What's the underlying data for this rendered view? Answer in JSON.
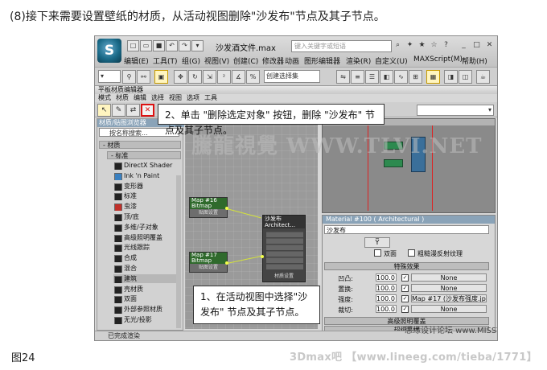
{
  "heading": "(8)接下来需要设置壁纸的材质，从活动视图删除\"沙发布\"节点及其子节点。",
  "caption": "图24",
  "footer_watermark": "3Dmax吧  【www.lineeg.com/tieba/1771】",
  "max_window": {
    "app_logo": "S",
    "doc_title": "沙发酒文件.max",
    "search_placeholder": "键入关键字或短语",
    "menus": [
      "编辑(E)",
      "工具(T)",
      "组(G)",
      "视图(V)",
      "创建(C)",
      "修改器",
      "动画",
      "图形编辑器",
      "渲染(R)",
      "自定义(U)",
      "MAXScript(M)",
      "帮助(H)"
    ],
    "toolbar": {
      "selection_set": "创建选择集",
      "ref_coord": ""
    }
  },
  "slate_editor": {
    "title": "平板材质编辑器",
    "menus": [
      "模式",
      "材质",
      "编辑",
      "选择",
      "视图",
      "选项",
      "工具"
    ],
    "browser": {
      "header": "材质/贴图浏览器",
      "search": "按名称搜索...",
      "category": "- 材质",
      "subcategory": "- 标准",
      "materials": [
        "DirectX Shader",
        "Ink 'n Paint",
        "变形器",
        "标准",
        "虫漆",
        "顶/底",
        "多维/子对象",
        "高级照明覆盖",
        "光线跟踪",
        "合成",
        "混合",
        "建筑",
        "壳材质",
        "双面",
        "外部参照材质",
        "无光/投影"
      ],
      "selected_index": 11
    },
    "nodes": {
      "map16_title": "Map #16",
      "map16_type": "Bitmap",
      "map16_body": "贴图设置",
      "map17_title": "Map #17",
      "map17_type": "Bitmap",
      "map17_body": "贴图设置",
      "sofa_title": "沙发布",
      "sofa_type": "Architect...",
      "sofa_body": "材质设置"
    },
    "callout_top": "2、单击 \"删除选定对象\" 按钮，删除 \"沙发布\" 节点及其子节点。",
    "callout_bottom_1": "1、在活动视图中选择\"沙",
    "callout_bottom_2": "发布\" 节点及其子节点。",
    "params": {
      "title": "Material #100 ( Architectural )",
      "material_name": "沙发布",
      "dropper": "Y̅",
      "two_sided": "双面",
      "rough_diffuse": "粗糙漫反射纹理",
      "rollout_special": "特殊效果",
      "rows": [
        {
          "label": "凹凸:",
          "value": "100.0",
          "map": "None"
        },
        {
          "label": "置换:",
          "value": "100.0",
          "map": "None"
        },
        {
          "label": "强度:",
          "value": "100.0",
          "map": "Map #17 (沙发布强度.jpg)"
        },
        {
          "label": "裁切:",
          "value": "100.0",
          "map": "None"
        }
      ],
      "rollouts": [
        "高级照明覆盖",
        "超级采样",
        "DirectX 管理器",
        "mental ray 连接"
      ]
    },
    "status": "已完成渲染"
  },
  "watermark": "騰龍視覺 WWW.TLVI.NET",
  "brand_watermark": "思缘设计论坛 www.MISSYUAN.COM"
}
